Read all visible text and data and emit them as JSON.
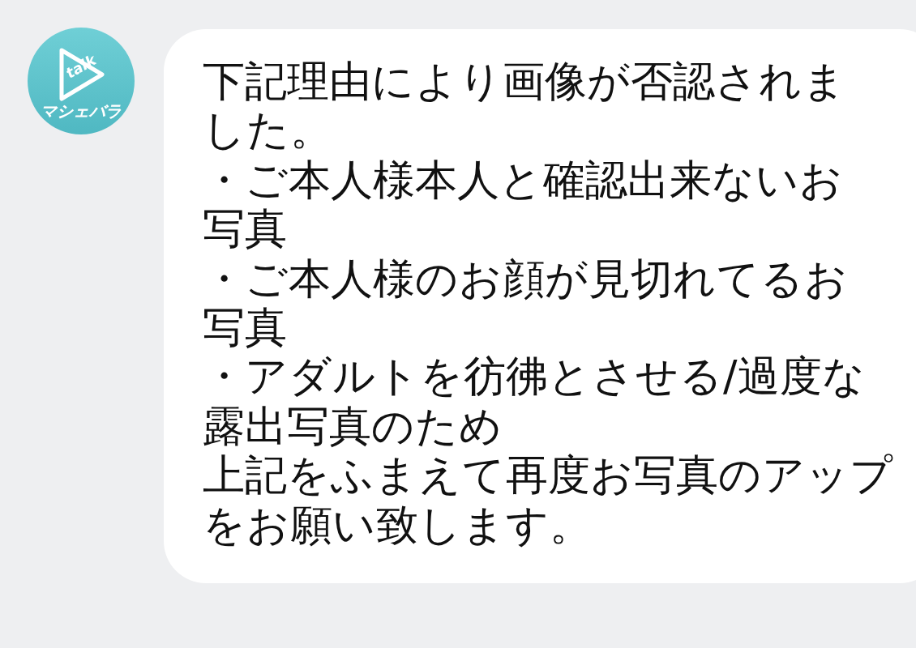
{
  "avatar": {
    "logo_word": "talk",
    "logo_name": "マシェバラ"
  },
  "message": {
    "lines": [
      "下記理由により画像が否認されま",
      "した。",
      "・ご本人様本人と確認出来ないお",
      "写真",
      "・ご本人様のお顔が見切れてるお",
      "写真",
      "・アダルトを彷彿とさせる/過度な",
      "露出写真のため",
      "上記をふまえて再度お写真のアップ",
      "をお願い致します。"
    ]
  }
}
